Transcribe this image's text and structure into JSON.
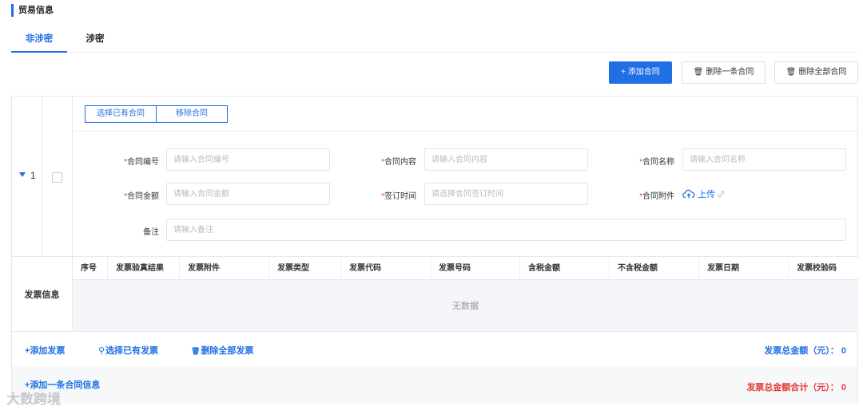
{
  "section": {
    "title": "贸易信息"
  },
  "tabs": [
    {
      "label": "非涉密",
      "active": true
    },
    {
      "label": "涉密",
      "active": false
    }
  ],
  "toolbar": {
    "add_contract": "+ 添加合同",
    "delete_one": "删除一条合同",
    "delete_all": "删除全部合同",
    "trash_icon": "🗑"
  },
  "contract": {
    "row_number": "1",
    "select_existing": "选择已有合同",
    "remove": "移除合同",
    "fields": {
      "number": {
        "label": "合同编号",
        "placeholder": "请输入合同编号"
      },
      "content": {
        "label": "合同内容",
        "placeholder": "请输入合同内容"
      },
      "name": {
        "label": "合同名称",
        "placeholder": "请输入合同名称"
      },
      "amount": {
        "label": "合同金额",
        "placeholder": "请输入合同金额"
      },
      "sign_time": {
        "label": "签订时间",
        "placeholder": "请选择合同签订时间"
      },
      "attachment": {
        "label": "合同附件",
        "upload": "上传"
      },
      "remark": {
        "label": "备注",
        "placeholder": "请输入备注"
      }
    }
  },
  "invoice": {
    "title": "发票信息",
    "columns": [
      "序号",
      "发票验真结果",
      "发票附件",
      "发票类型",
      "发票代码",
      "发票号码",
      "含税金额",
      "不含税金额",
      "发票日期",
      "发票校验码"
    ],
    "empty_text": "无数据",
    "add": "+添加发票",
    "select_existing": "选择已有发票",
    "delete_all": "删除全部发票",
    "total_label": "发票总金额（元）：",
    "total_value": "0"
  },
  "footer": {
    "add_contract_info": "+添加一条合同信息",
    "grand_total_label": "发票总金额合计（元）：",
    "grand_total_value": "0"
  },
  "watermark": "大数跨境",
  "colors": {
    "primary": "#1f6fe5",
    "danger": "#e53935"
  }
}
